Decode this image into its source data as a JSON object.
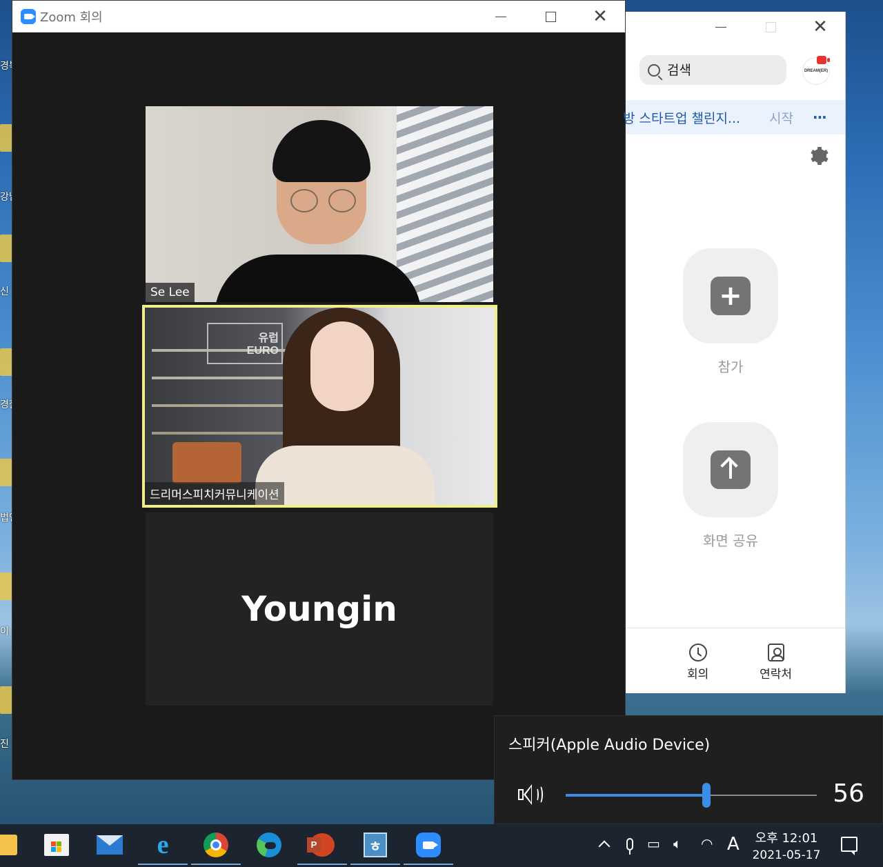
{
  "meeting_window": {
    "title": "Zoom 회의",
    "participants": [
      {
        "name": "Se Lee"
      },
      {
        "name": "드리머스피치커뮤니케이션",
        "active_speaker": true
      },
      {
        "name": "Youngin",
        "video_off": true
      }
    ],
    "background_sign_text": "유럽\nEURO"
  },
  "home_window": {
    "search_placeholder": "검색",
    "avatar_text": "DREAM(ER)",
    "upcoming_meeting": {
      "title": "방 스타트업 챌린지...",
      "start_label": "시작",
      "more_label": "···"
    },
    "actions": {
      "join_label": "참가",
      "share_label": "화면 공유"
    },
    "bottom_nav": {
      "meetings_label": "회의",
      "contacts_label": "연락처"
    }
  },
  "volume_flyout": {
    "device_name": "스피커(Apple Audio Device)",
    "volume": 56
  },
  "taskbar": {
    "apps": [
      "file-explorer",
      "microsoft-store",
      "mail",
      "internet-explorer",
      "chrome",
      "edge",
      "powerpoint",
      "hwp",
      "zoom"
    ],
    "hwp_glyph": "ㅎ",
    "ppt_glyph": "P",
    "ie_glyph": "e",
    "ime_indicator": "A",
    "clock": {
      "time": "오후 12:01",
      "date": "2021-05-17"
    }
  },
  "desktop": {
    "left_edge_labels": [
      "경복\n한국",
      "강남",
      "신",
      "경찰",
      "법인",
      "이\n국제",
      "진\n명"
    ]
  },
  "colors": {
    "zoom_blue": "#2d8cff",
    "active_speaker_border": "#f0ef8a",
    "banner_text": "#2057a8",
    "volume_accent": "#3a8ee6"
  }
}
